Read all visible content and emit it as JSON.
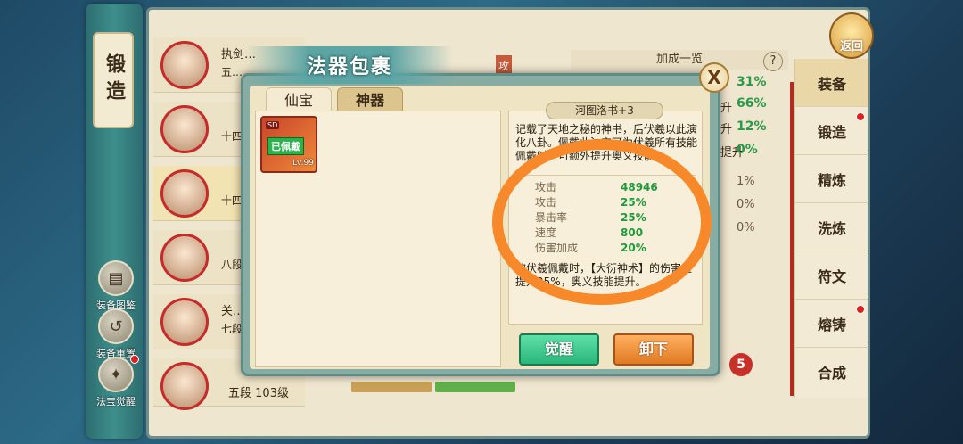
{
  "left_menu": {
    "forge_label": "锻造",
    "buttons": [
      {
        "label": "装备图鉴",
        "icon": "book-icon"
      },
      {
        "label": "装备重置",
        "icon": "reset-icon"
      },
      {
        "label": "法宝觉醒",
        "icon": "awaken-icon"
      }
    ]
  },
  "heroes": [
    {
      "name": "执剑…",
      "sub": "五…"
    },
    {
      "name": "",
      "sub": "十四…"
    },
    {
      "name": "",
      "sub": "十四…"
    },
    {
      "name": "",
      "sub": "八段"
    },
    {
      "name": "关…",
      "sub": "七段"
    },
    {
      "name": "",
      "sub": "五段"
    }
  ],
  "bottom_hero": {
    "rank": "五段",
    "level": "103级"
  },
  "bonus": {
    "header": "加成一览",
    "lines": [
      {
        "label": "",
        "value": "31%"
      },
      {
        "label": "升",
        "value": "66%"
      },
      {
        "label": "升",
        "value": "12%"
      },
      {
        "label": "提升",
        "value": "0%"
      }
    ],
    "small_lines": [
      "1%",
      "0%",
      "0%"
    ]
  },
  "attack_tag": "攻",
  "return_label": "返回",
  "help_label": "?",
  "right_tabs": [
    {
      "label": "装备",
      "active": true,
      "dot": false
    },
    {
      "label": "锻造",
      "active": false,
      "dot": true
    },
    {
      "label": "精炼",
      "active": false,
      "dot": false
    },
    {
      "label": "洗炼",
      "active": false,
      "dot": false
    },
    {
      "label": "符文",
      "active": false,
      "dot": false
    },
    {
      "label": "熔铸",
      "active": false,
      "dot": true
    },
    {
      "label": "合成",
      "active": false,
      "dot": false
    }
  ],
  "modal": {
    "title": "法器包裹",
    "close_label": "X",
    "tabs": {
      "xianbao": "仙宝",
      "shenqi": "神器"
    },
    "item": {
      "equipped_label": "已佩戴",
      "level": "Lv.99",
      "tag": "SD"
    },
    "detail": {
      "name": "河图洛书+3",
      "description": "记载了天地之秘的神书，后伏羲以此演化八卦。佩戴此法宝可为伏羲所有技能佩戴时，可额外提升奥义技能。",
      "stats": [
        {
          "name": "攻击",
          "value": "48946"
        },
        {
          "name": "攻击",
          "value": "25%"
        },
        {
          "name": "暴击率",
          "value": "25%"
        },
        {
          "name": "速度",
          "value": "800"
        },
        {
          "name": "伤害加成",
          "value": "20%"
        }
      ],
      "effect": "被伏羲佩戴时，【大衍神术】的伤害量提升25%，奥义技能提升。"
    },
    "buttons": {
      "awaken": "觉醒",
      "unequip": "卸下"
    }
  },
  "badge_count": "5",
  "colors": {
    "stat_green": "#1f9a3c",
    "highlight": "#f7892a",
    "frame": "#86aca4"
  }
}
